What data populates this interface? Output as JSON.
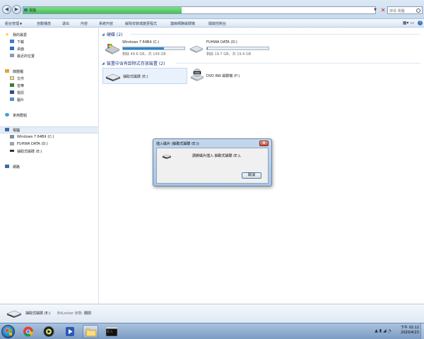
{
  "address": {
    "text": "電腦",
    "progress": 0.45
  },
  "search": {
    "placeholder": "搜尋 電腦"
  },
  "toolbar": {
    "items": [
      "組合管理",
      "自動播放",
      "退出",
      "內容",
      "系統內容",
      "解除安裝或變更程式",
      "連線網路磁碟機",
      "開啟控制台"
    ]
  },
  "nav": {
    "favorites": "我的最愛",
    "downloads": "下載",
    "desktop": "桌面",
    "recent": "最近的位置",
    "libraries": "媒體櫃",
    "documents": "文件",
    "music": "音樂",
    "videos": "視訊",
    "pictures": "圖片",
    "homegroup": "家用群組",
    "computer": "電腦",
    "drive_c": "Windows 7 64Bit (C:)",
    "drive_d": "FUHWA DATA (D:)",
    "drive_e": "抽取式磁碟 (E:)",
    "network": "網路"
  },
  "content": {
    "hdd_header": "硬碟 (2)",
    "removable_header": "裝置中含有卸除式存放裝置 (2)",
    "drives": [
      {
        "name": "Windows 7 64Bit (C:)",
        "free": "剩餘 49.6 GB，共 149 GB",
        "used_fraction": 0.667
      },
      {
        "name": "FUHWA DATA (D:)",
        "free": "剩餘 19.7 GB，共 19.9 GB",
        "used_fraction": 0.01
      }
    ],
    "removable": [
      {
        "name": "抽取式磁碟 (E:)"
      },
      {
        "name": "DVD RW 磁碟機 (F:)"
      }
    ]
  },
  "dialog": {
    "title": "插入磁片 (抽取式磁碟 (E:))",
    "close": "X",
    "message": "請將磁片插入 抽取式磁碟 (E:)。",
    "cancel": "取消"
  },
  "details": {
    "name": "抽取式磁碟 (E:)",
    "bitlocker_label": "BitLocker 狀態:",
    "bitlocker_value": "關閉"
  },
  "taskbar": {
    "time": "下午 02:12",
    "date": "2020/4/23"
  }
}
